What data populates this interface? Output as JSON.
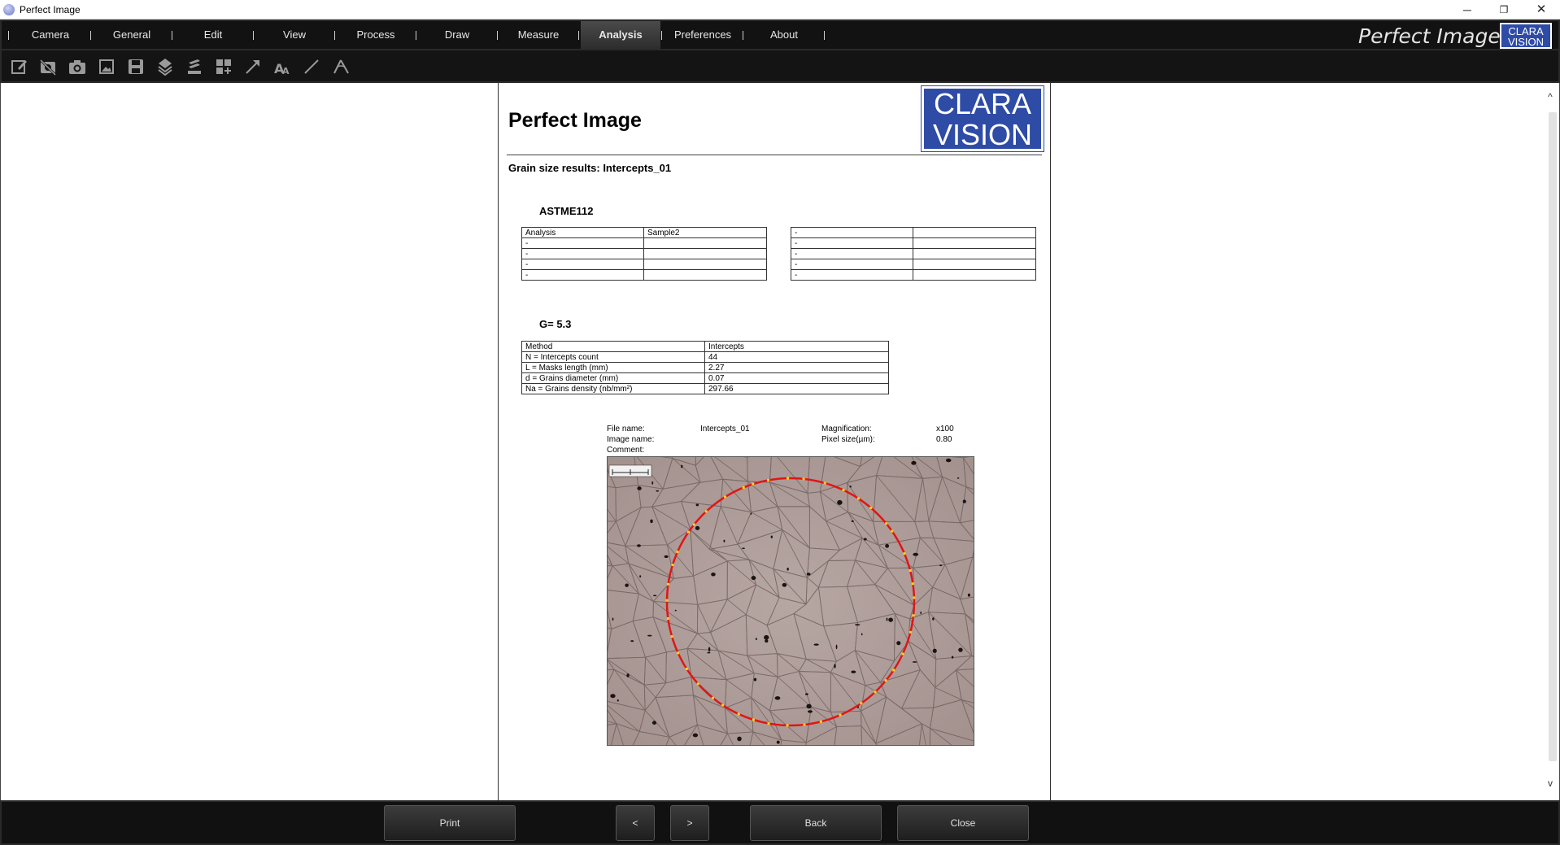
{
  "window": {
    "title": "Perfect Image",
    "minimize": "─",
    "maximize": "❐",
    "close": "✕"
  },
  "menu": {
    "items": [
      "Camera",
      "General",
      "Edit",
      "View",
      "Process",
      "Draw",
      "Measure",
      "Analysis",
      "Preferences",
      "About"
    ],
    "active": "Analysis"
  },
  "brand": {
    "title": "Perfect Image",
    "logo_line1": "CLARA",
    "logo_line2": "VISION",
    "logo_color": "#2e4ba6"
  },
  "toolbar": {
    "icons": [
      "edit-icon",
      "no-camera-icon",
      "camera-icon",
      "image-icon",
      "save-icon",
      "layers-icon",
      "stack-icon",
      "grid-icon",
      "arrow-icon",
      "text-icon",
      "line-icon",
      "angle-icon"
    ]
  },
  "report": {
    "title": "Perfect Image",
    "logo_line1": "CLARA",
    "logo_line2": "VISION",
    "subtitle": "Grain size results: Intercepts_01",
    "standard": "ASTME112",
    "table_left": [
      [
        "Analysis",
        "Sample2"
      ],
      [
        "-",
        ""
      ],
      [
        "-",
        ""
      ],
      [
        "-",
        ""
      ],
      [
        "-",
        ""
      ]
    ],
    "table_right": [
      [
        "-",
        ""
      ],
      [
        "-",
        ""
      ],
      [
        "-",
        ""
      ],
      [
        "-",
        ""
      ],
      [
        "-",
        ""
      ]
    ],
    "g_value": "G= 5.3",
    "results_table": [
      [
        "Method",
        "Intercepts"
      ],
      [
        "N = Intercepts count",
        "44"
      ],
      [
        "L = Masks length (mm)",
        "2.27"
      ],
      [
        "d = Grains diameter (mm)",
        "0.07"
      ],
      [
        "Na = Grains density (nb/mm²)",
        "297.66"
      ]
    ],
    "meta": {
      "file_name_label": "File name:",
      "file_name": "Intercepts_01",
      "image_name_label": "Image name:",
      "image_name": "",
      "comment_label": "Comment:",
      "comment": "",
      "magnification_label": "Magnification:",
      "magnification": "x100",
      "pixel_size_label": "Pixel size(µm):",
      "pixel_size": "0.80"
    },
    "circle_color": "#e01616",
    "intercept_color": "#ffd21a"
  },
  "scroll": {
    "up": "^",
    "down": "v"
  },
  "buttons": {
    "print": "Print",
    "prev": "<",
    "next": ">",
    "back": "Back",
    "close": "Close"
  }
}
